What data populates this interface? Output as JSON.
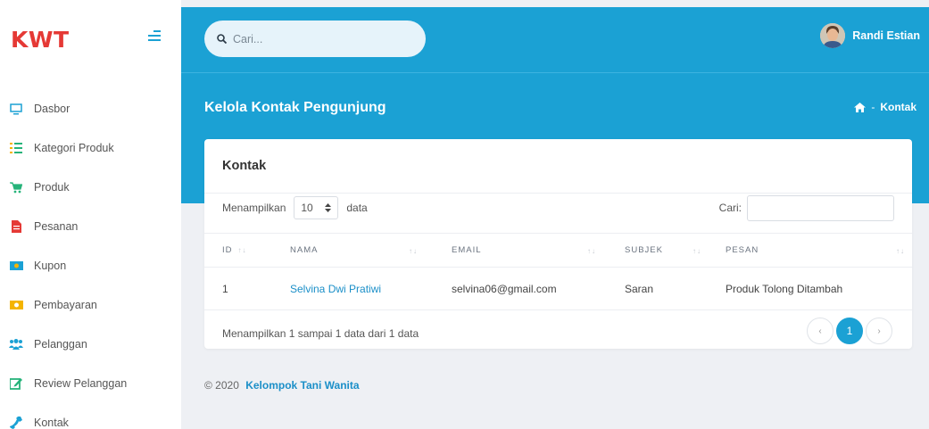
{
  "brand": "KWT",
  "sidebar": {
    "items": [
      {
        "label": "Dasbor",
        "icon": "monitor-icon"
      },
      {
        "label": "Kategori Produk",
        "icon": "list-icon"
      },
      {
        "label": "Produk",
        "icon": "cart-icon"
      },
      {
        "label": "Pesanan",
        "icon": "file-icon"
      },
      {
        "label": "Kupon",
        "icon": "money-icon"
      },
      {
        "label": "Pembayaran",
        "icon": "money-icon"
      },
      {
        "label": "Pelanggan",
        "icon": "users-icon"
      },
      {
        "label": "Review Pelanggan",
        "icon": "edit-icon"
      },
      {
        "label": "Kontak",
        "icon": "phone-icon"
      }
    ]
  },
  "topbar": {
    "search_placeholder": "Cari...",
    "user_name": "Randi Estian"
  },
  "header": {
    "title": "Kelola Kontak Pengunjung",
    "breadcrumb_sep": "-",
    "breadcrumb_current": "Kontak"
  },
  "card": {
    "title": "Kontak",
    "show_prefix": "Menampilkan",
    "show_value": "10",
    "show_suffix": "data",
    "search_label": "Cari:",
    "columns": [
      "ID",
      "NAMA",
      "EMAIL",
      "SUBJEK",
      "PESAN"
    ],
    "rows": [
      {
        "id": "1",
        "nama": "Selvina Dwi Pratiwi",
        "email": "selvina06@gmail.com",
        "subjek": "Saran",
        "pesan": "Produk Tolong Ditambah"
      }
    ],
    "info": "Menampilkan 1 sampai 1 data dari 1 data",
    "pagination": {
      "prev": "‹",
      "current": "1",
      "next": "›"
    }
  },
  "footer": {
    "copyright": "© 2020",
    "org": "Kelompok Tani Wanita"
  },
  "colors": {
    "primary": "#1ba1d4",
    "brand": "#e53935",
    "icon_green": "#26b37a",
    "icon_red": "#e53935",
    "icon_yellow": "#f4b400",
    "icon_blue": "#1ba1d4"
  }
}
